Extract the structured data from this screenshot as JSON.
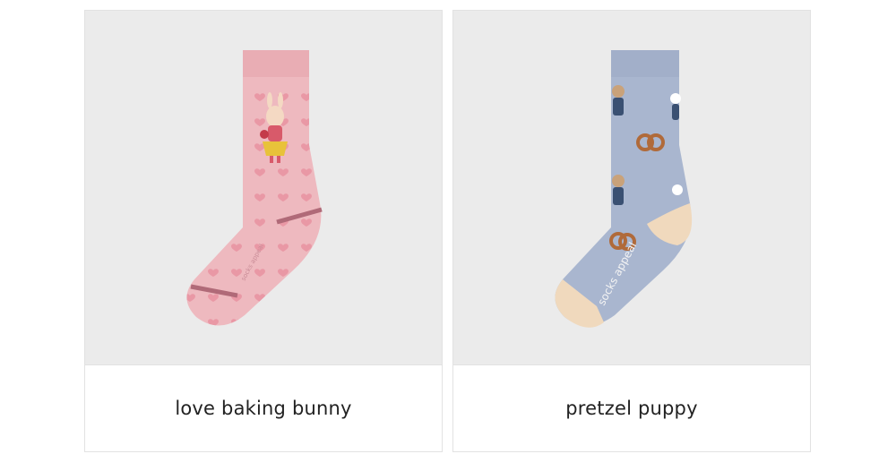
{
  "products": [
    {
      "name": "love baking bunny",
      "image_icon": "pink-bunny-sock-image",
      "sock_color": "#eeb9bf",
      "stripe_color": "#b06a78",
      "brand_print": "socks appeal"
    },
    {
      "name": "pretzel puppy",
      "image_icon": "blue-pretzel-sock-image",
      "sock_color": "#a9b6cf",
      "accent_color": "#f0d9bd",
      "brand_print": "socks appeal"
    }
  ]
}
